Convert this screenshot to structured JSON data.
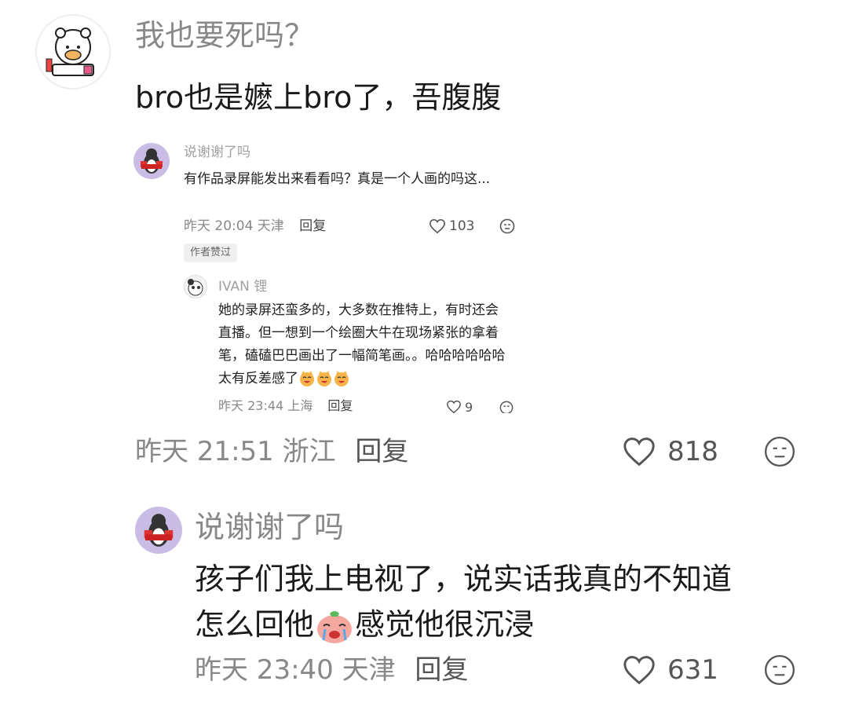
{
  "comment1": {
    "username": "我也要死吗？",
    "text": "bro也是嬷上bro了，吾腹腹",
    "meta": "昨天 21:51 浙江",
    "reply_label": "回复",
    "like_count": "818"
  },
  "quote": {
    "username": "说谢谢了吗",
    "avatar_caption": "说谢谢了吗",
    "text": "有作品录屏能发出来看看吗？真是一个人画的吗这...",
    "meta": "昨天 20:04 天津",
    "reply_label": "回复",
    "like_count": "103",
    "author_badge": "作者赞过",
    "reply": {
      "username": "IVAN 锂",
      "text": "她的录屏还蛮多的，大多数在推特上，有时还会直播。但一想到一个绘圈大牛在现场紧张的拿着笔，磕磕巴巴画出了一幅简笔画。。哈哈哈哈哈哈太有反差感了",
      "meta": "昨天 23:44 上海",
      "reply_label": "回复",
      "like_count": "9"
    }
  },
  "comment2": {
    "username": "说谢谢了吗",
    "avatar_caption": "说谢谢了吗",
    "text_line1": "孩子们我上电视了，说实话我真的不知道",
    "text_line2a": "怎么回他",
    "text_line2b": "感觉他很沉浸",
    "meta": "昨天 23:40 天津",
    "reply_label": "回复",
    "like_count": "631"
  },
  "icons": [
    "heart-icon",
    "dislike-face-icon",
    "laughing-cat-emoji",
    "crying-face-emoji"
  ],
  "colors": {
    "muted": "#8a8a8a",
    "avatar_purple": "#c9bde6",
    "text": "#1a1a1a"
  }
}
